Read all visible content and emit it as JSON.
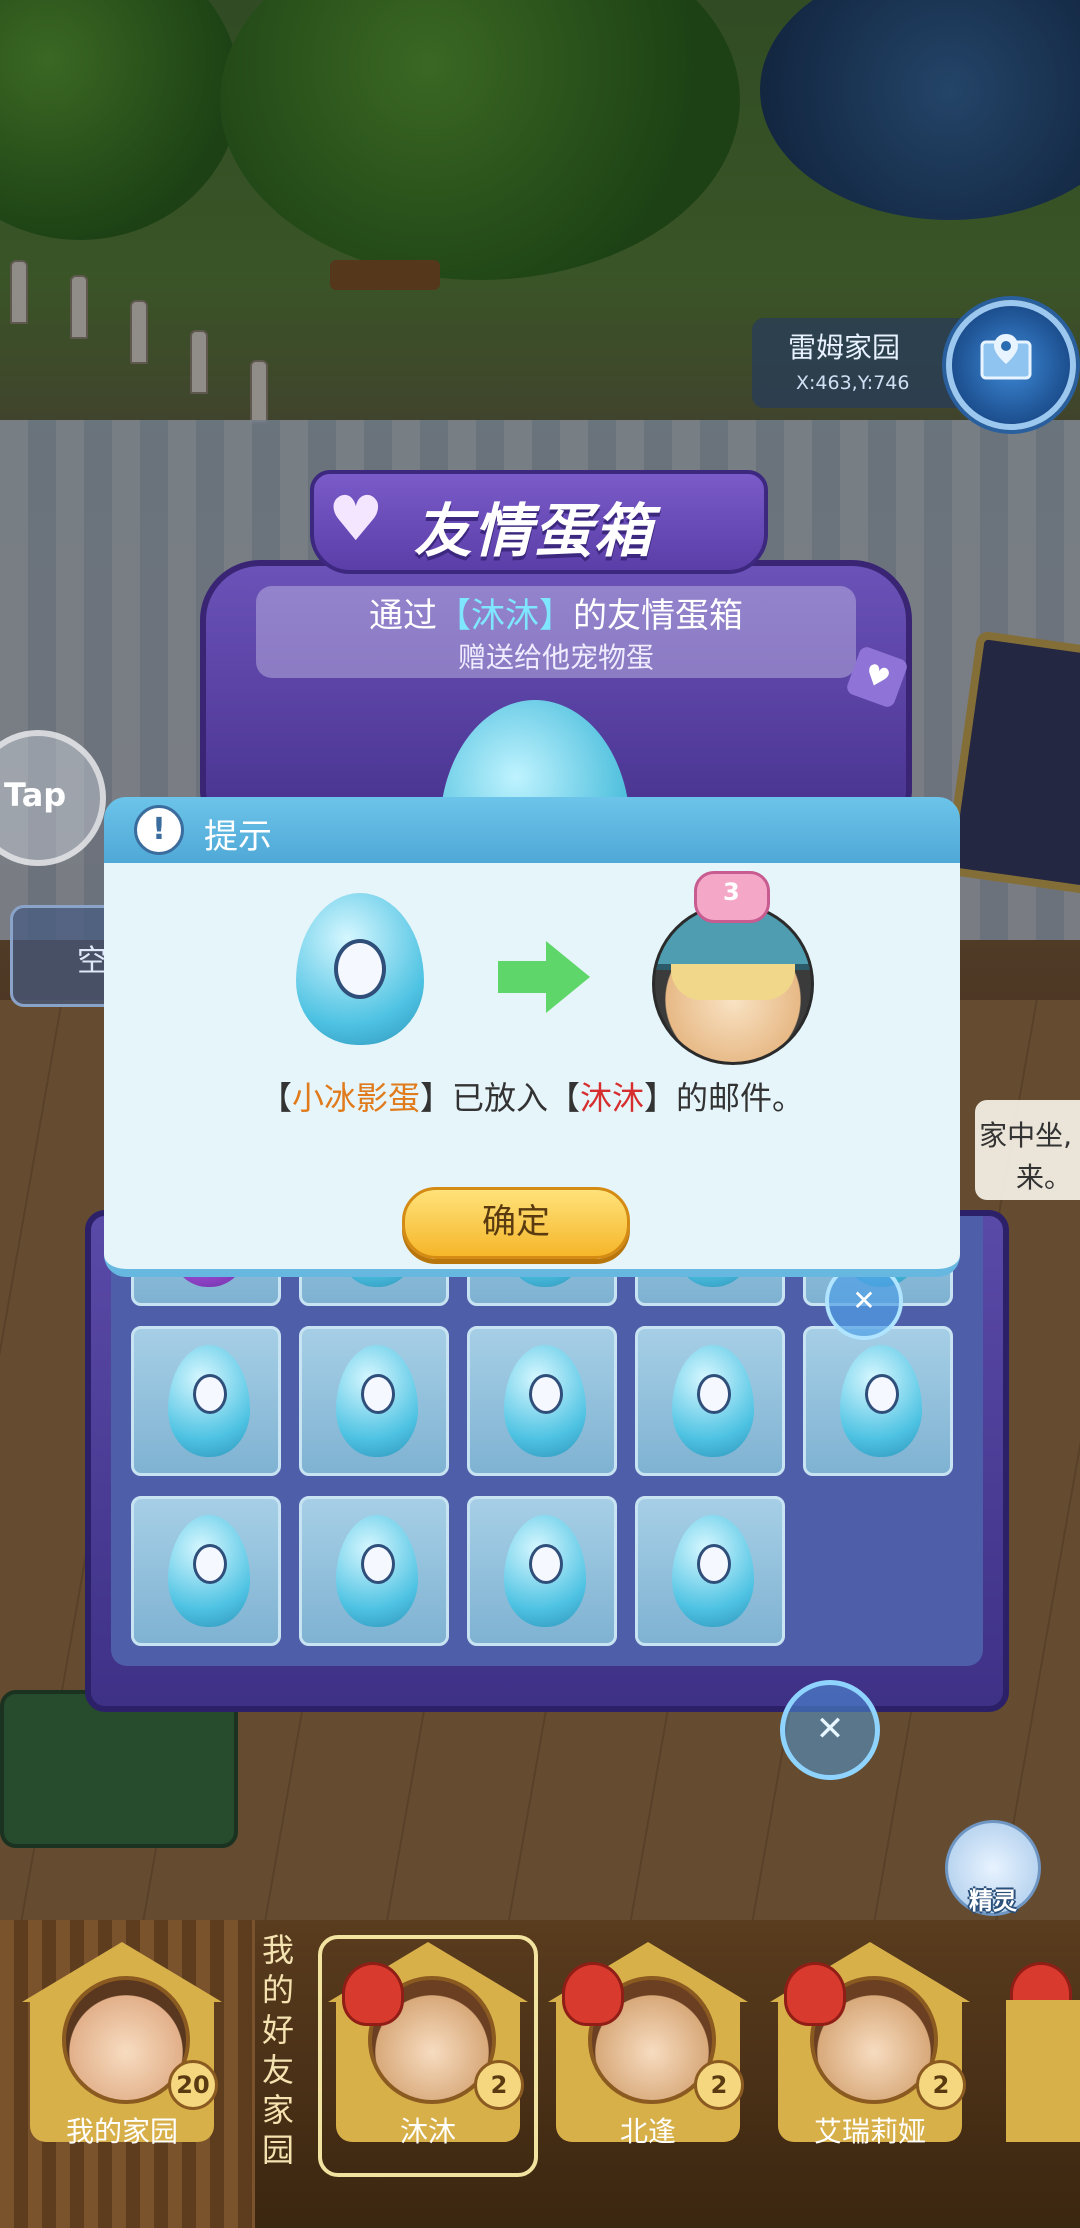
{
  "location": {
    "name": "雷姆家园",
    "coords": "X:463,Y:746"
  },
  "side": {
    "tap_label": "Tap",
    "chip_label": "空"
  },
  "egg_box": {
    "title": "友情蛋箱",
    "line1_prefix": "通过",
    "line1_friend": "【沐沐】",
    "line1_suffix": "的友情蛋箱",
    "line2": "赠送给他宠物蛋"
  },
  "dialog": {
    "title": "提示",
    "msg_open1": "【",
    "msg_egg": "小冰影蛋",
    "msg_mid": "】已放入【",
    "msg_friend": "沐沐",
    "msg_end": "】的邮件。",
    "badge_level": "3",
    "confirm_label": "确定"
  },
  "right_bubble": {
    "line1": "家中坐,",
    "line2": "来。"
  },
  "sprite_button": {
    "label": "精灵"
  },
  "friends_bar": {
    "label": "我的好友家园",
    "my_home": {
      "name": "我的家园",
      "level": "20"
    },
    "friends": [
      {
        "name": "沐沐",
        "level": "2"
      },
      {
        "name": "北逢",
        "level": "2"
      },
      {
        "name": "艾瑞莉娅",
        "level": "2"
      }
    ]
  },
  "colors": {
    "dialog_header": "#4fa8d6",
    "confirm": "#f5b62a",
    "egg_name": "#e07a1a",
    "friend_name": "#d62e2e"
  }
}
